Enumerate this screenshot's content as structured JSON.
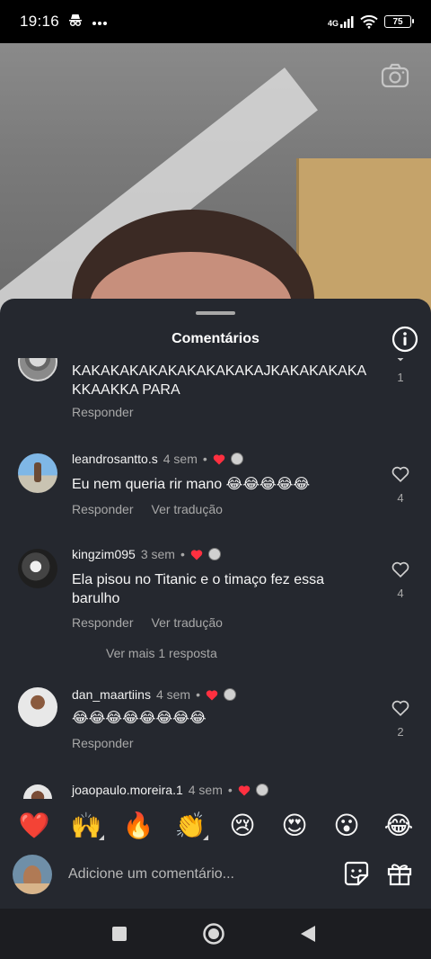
{
  "status_bar": {
    "time": "19:16",
    "network": "4G",
    "battery": "75"
  },
  "sheet": {
    "title": "Comentários"
  },
  "comments": [
    {
      "username": "",
      "time": "",
      "text": "KAKAKAKAKAKAKAKAKAKAJKAKAKAKAKAKKAAKKA PARA",
      "actions": [
        "Responder"
      ],
      "likes": "1"
    },
    {
      "username": "leandrosantto.s",
      "time": "4 sem",
      "text": "Eu nem queria rir mano 😂😂😂😂😂",
      "actions": [
        "Responder",
        "Ver tradução"
      ],
      "likes": "4"
    },
    {
      "username": "kingzim095",
      "time": "3 sem",
      "text": "Ela pisou no Titanic e o timaço fez essa barulho",
      "actions": [
        "Responder",
        "Ver tradução"
      ],
      "likes": "4"
    },
    {
      "username": "dan_maartiins",
      "time": "4 sem",
      "text": "😂😂😂😂😂😂😂😂",
      "actions": [
        "Responder"
      ],
      "likes": "2"
    },
    {
      "username": "joaopaulo.moreira.1",
      "time": "4 sem",
      "text": "",
      "actions": [],
      "likes": ""
    }
  ],
  "see_more_replies": "Ver mais 1 resposta",
  "dot": "•",
  "reactions": [
    "❤️",
    "🙌",
    "🔥",
    "👏",
    "😢",
    "😍",
    "😮",
    "😂"
  ],
  "composer": {
    "placeholder": "Adicione um comentário..."
  },
  "icons": {
    "camera": "camera-icon",
    "info": "info-icon",
    "heart": "heart-outline-icon",
    "chevron": "chevron-down-icon",
    "sticker": "sticker-icon",
    "gift": "gift-icon"
  },
  "colors": {
    "sheet_bg": "#25282f",
    "muted_text": "#a8a8a8",
    "like_red": "#ff3040"
  }
}
